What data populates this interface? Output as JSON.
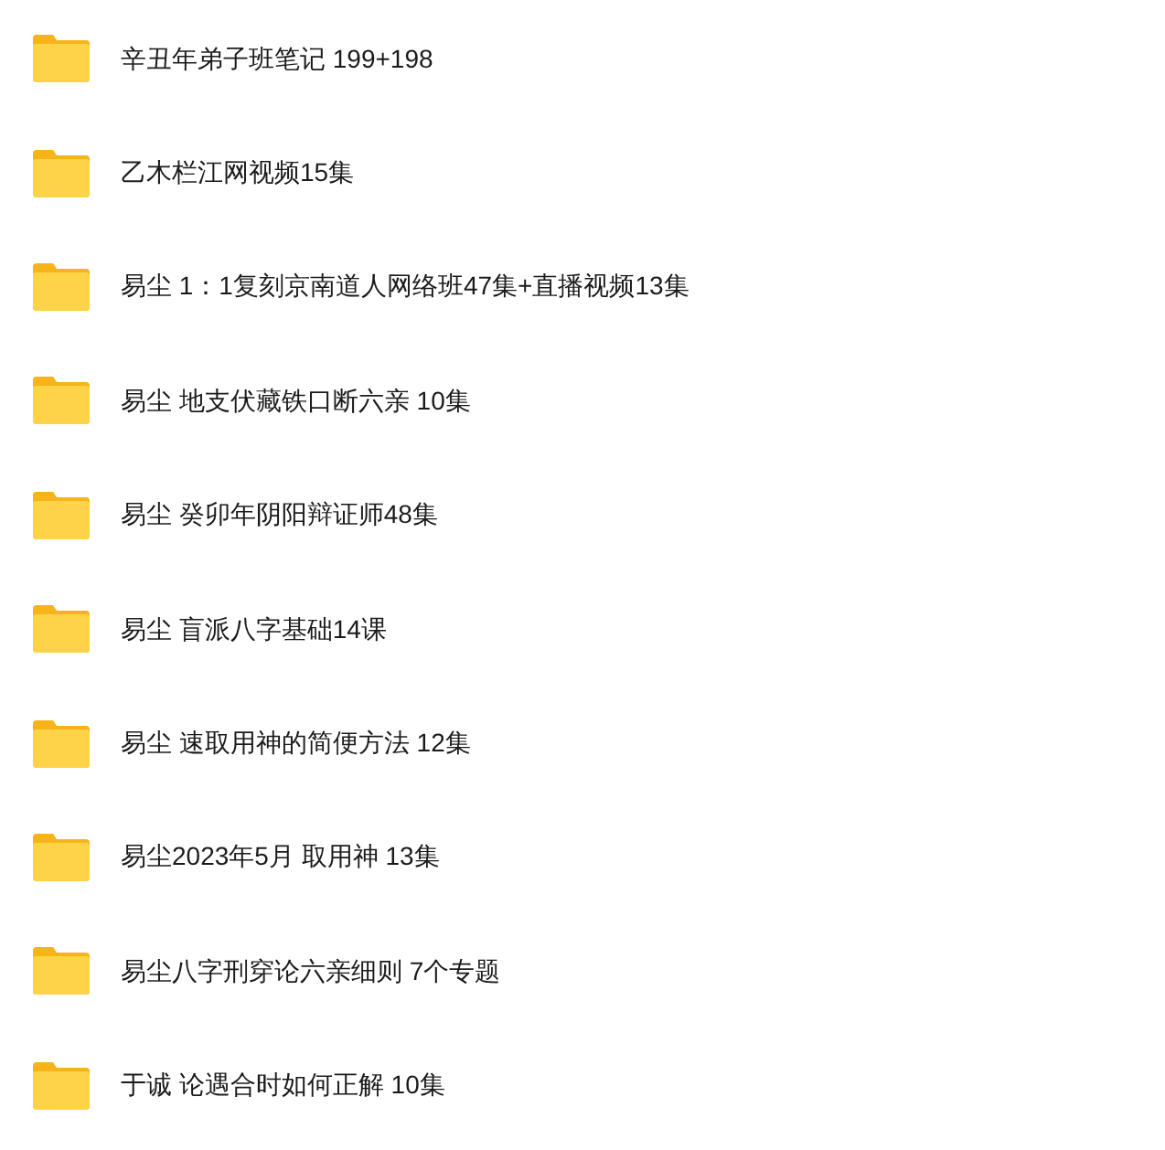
{
  "folders": [
    {
      "name": "辛丑年弟子班笔记 199+198"
    },
    {
      "name": "乙木栏江网视频15集"
    },
    {
      "name": "易尘 1：1复刻京南道人网络班47集+直播视频13集"
    },
    {
      "name": "易尘 地支伏藏铁口断六亲 10集"
    },
    {
      "name": "易尘 癸卯年阴阳辩证师48集"
    },
    {
      "name": "易尘 盲派八字基础14课"
    },
    {
      "name": "易尘 速取用神的简便方法 12集"
    },
    {
      "name": "易尘2023年5月 取用神 13集"
    },
    {
      "name": "易尘八字刑穿论六亲细则 7个专题"
    },
    {
      "name": "于诚 论遇合时如何正解 10集"
    }
  ]
}
